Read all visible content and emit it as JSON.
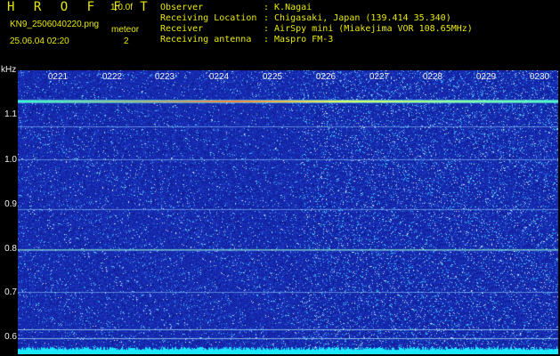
{
  "header": {
    "app_title": "HROFFT",
    "version": "1.0.0f",
    "filename": "KN9_2506040220.png",
    "meteor_label": "meteor",
    "datetime": "25.06.04 02:20",
    "meteor_count": "2"
  },
  "info": [
    {
      "label": "Observer",
      "value": ": K.Nagai"
    },
    {
      "label": "Receiving Location",
      "value": ": Chigasaki, Japan (139.414 35.340)"
    },
    {
      "label": "Receiver",
      "value": ": AirSpy mini (Miakejima VOR 108.65MHz)"
    },
    {
      "label": "Receiving antenna",
      "value": ": Maspro FM-3"
    }
  ],
  "axis": {
    "y_unit": "kHz",
    "y_ticks": [
      "1.1",
      "1.0",
      "0.9",
      "0.8",
      "0.7",
      "0.6"
    ],
    "x_ticks": [
      "0221",
      "0222",
      "0223",
      "0224",
      "0225",
      "0226",
      "0227",
      "0228",
      "0229",
      "0230"
    ]
  },
  "colors": {
    "text": "#e8e800",
    "axis_text": "#f0f0f0",
    "background_noise": "#1a2bb0",
    "carrier": "#00ffe0",
    "bottom_band": "#19e8ff"
  }
}
